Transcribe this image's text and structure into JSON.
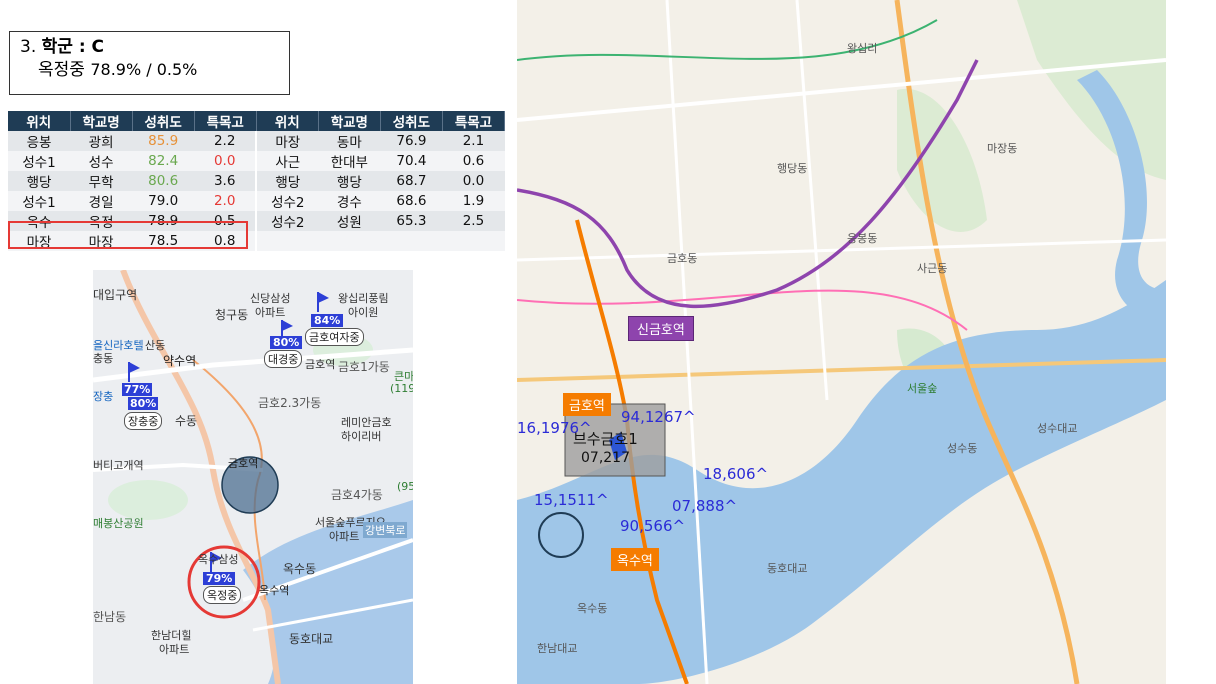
{
  "title": {
    "number": "3.",
    "heading": "학군 : C",
    "subtitle_school": "옥정중",
    "subtitle_values": "78.9% / 0.5%"
  },
  "table": {
    "headers": [
      "위치",
      "학교명",
      "성취도",
      "특목고",
      "위치",
      "학교명",
      "성취도",
      "특목고"
    ],
    "rows": [
      [
        {
          "v": "응봉"
        },
        {
          "v": "광희"
        },
        {
          "v": "85.9",
          "c": "orange"
        },
        {
          "v": "2.2"
        },
        {
          "v": "마장"
        },
        {
          "v": "동마"
        },
        {
          "v": "76.9"
        },
        {
          "v": "2.1"
        }
      ],
      [
        {
          "v": "성수1"
        },
        {
          "v": "성수"
        },
        {
          "v": "82.4",
          "c": "green"
        },
        {
          "v": "0.0",
          "c": "red"
        },
        {
          "v": "사근"
        },
        {
          "v": "한대부"
        },
        {
          "v": "70.4"
        },
        {
          "v": "0.6"
        }
      ],
      [
        {
          "v": "행당"
        },
        {
          "v": "무학"
        },
        {
          "v": "80.6",
          "c": "green"
        },
        {
          "v": "3.6"
        },
        {
          "v": "행당"
        },
        {
          "v": "행당"
        },
        {
          "v": "68.7"
        },
        {
          "v": "0.0"
        }
      ],
      [
        {
          "v": "성수1"
        },
        {
          "v": "경일"
        },
        {
          "v": "79.0"
        },
        {
          "v": "2.0",
          "c": "red"
        },
        {
          "v": "성수2"
        },
        {
          "v": "경수"
        },
        {
          "v": "68.6"
        },
        {
          "v": "1.9"
        }
      ],
      [
        {
          "v": "옥수"
        },
        {
          "v": "옥정"
        },
        {
          "v": "78.9"
        },
        {
          "v": "0.5"
        },
        {
          "v": "성수2"
        },
        {
          "v": "성원"
        },
        {
          "v": "65.3"
        },
        {
          "v": "2.5"
        }
      ],
      [
        {
          "v": "마장"
        },
        {
          "v": "마장"
        },
        {
          "v": "78.5"
        },
        {
          "v": "0.8"
        },
        {
          "v": ""
        },
        {
          "v": ""
        },
        {
          "v": ""
        },
        {
          "v": ""
        }
      ]
    ]
  },
  "left_map": {
    "labels": [
      "대입구역",
      "신당삼성",
      "아파트",
      "왕십리풍림",
      "아이원",
      "청구동",
      "84%",
      "금호여자중",
      "80%",
      "대경중",
      "금호역",
      "금호1가동",
      "큰마",
      "(119",
      "을신라호텔",
      "산동",
      "충동",
      "약수역",
      "77%",
      "80%",
      "장충중",
      "장충",
      "수동",
      "금호2.3가동",
      "레미안금호",
      "하이리버",
      "버티고개역",
      "금호역",
      "금호4가동",
      "(95",
      "매봉산공원",
      "서울숲푸르지오",
      "아파트",
      "강변북로",
      "옥수삼성",
      "79%",
      "옥정중",
      "옥수동",
      "옥수역",
      "한남동",
      "한남더힐",
      "아파트",
      "동호대교"
    ]
  },
  "right_map": {
    "labels": [
      "신금호역",
      "금호역",
      "옥수역",
      "16,1976^",
      "94,1267^",
      "브수금호1",
      "07,217",
      "18,606^",
      "15,1511^",
      "07,888^",
      "90,566^",
      "성수동",
      "행당동",
      "왕십리",
      "서울숲",
      "응봉동",
      "마장동",
      "사근동",
      "옥수동",
      "금호동",
      "한남대교",
      "동호대교",
      "성수대교"
    ]
  },
  "colors": {
    "header_bg": "#1f3c55",
    "highlight": "#e53935",
    "line5": "#8e44ad",
    "line3": "#f57c00",
    "river": "#9fc6e8"
  }
}
